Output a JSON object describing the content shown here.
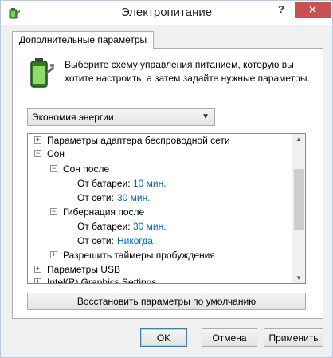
{
  "window": {
    "title": "Электропитание"
  },
  "titlebar": {
    "help_label": "?",
    "close_label": "✕"
  },
  "tab": {
    "label": "Дополнительные параметры"
  },
  "description": "Выберите схему управления питанием, которую вы хотите настроить, а затем задайте нужные параметры.",
  "plan_select": {
    "value": "Экономия энергии"
  },
  "tree": {
    "row0": {
      "exp": "+",
      "label": "Параметры адаптера беспроводной сети"
    },
    "row1": {
      "exp": "−",
      "label": "Сон"
    },
    "row2": {
      "exp": "−",
      "label": "Сон после"
    },
    "row3": {
      "label": "От батареи:",
      "value": "10 мин."
    },
    "row4": {
      "label": "От сети:",
      "value": "30 мин."
    },
    "row5": {
      "exp": "−",
      "label": "Гибернация после"
    },
    "row6": {
      "label": "От батареи:",
      "value": "30 мин."
    },
    "row7": {
      "label": "От сети:",
      "value": "Никогда"
    },
    "row8": {
      "exp": "+",
      "label": "Разрешить таймеры пробуждения"
    },
    "row9": {
      "exp": "+",
      "label": "Параметры USB"
    },
    "row10": {
      "exp": "+",
      "label": "Intel(R) Graphics Settings"
    }
  },
  "restore_label": "Восстановить параметры по умолчанию",
  "buttons": {
    "ok": "OK",
    "cancel": "Отмена",
    "apply": "Применить"
  },
  "icons": {
    "app": "power-options-icon",
    "battery": "battery-plug-icon"
  },
  "colors": {
    "value_link": "#0066cc",
    "close_bg": "#c75050"
  }
}
